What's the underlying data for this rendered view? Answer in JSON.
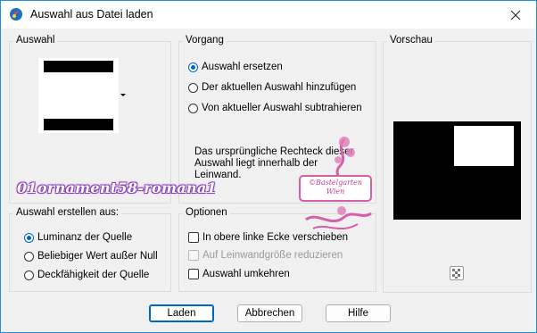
{
  "window": {
    "title": "Auswahl aus Datei laden"
  },
  "selection_panel": {
    "legend": "Auswahl"
  },
  "operation_panel": {
    "legend": "Vorgang",
    "options": [
      {
        "label": "Auswahl ersetzen",
        "selected": true
      },
      {
        "label": "Der aktuellen Auswahl hinzufügen",
        "selected": false
      },
      {
        "label": "Von aktueller Auswahl subtrahieren",
        "selected": false
      }
    ],
    "description": "Das ursprüngliche Rechteck dieser Auswahl liegt innerhalb der Leinwand."
  },
  "preview_panel": {
    "legend": "Vorschau"
  },
  "create_from_panel": {
    "legend": "Auswahl erstellen aus:",
    "options": [
      {
        "label": "Luminanz der Quelle",
        "selected": true
      },
      {
        "label": "Beliebiger Wert außer Null",
        "selected": false
      },
      {
        "label": "Deckfähigkeit der Quelle",
        "selected": false
      }
    ]
  },
  "options_panel": {
    "legend": "Optionen",
    "checks": [
      {
        "label": "In obere linke Ecke verschieben",
        "checked": false,
        "disabled": false
      },
      {
        "label": "Auf Leinwandgröße reduzieren",
        "checked": false,
        "disabled": true
      },
      {
        "label": "Auswahl umkehren",
        "checked": false,
        "disabled": false
      }
    ]
  },
  "buttons": {
    "load": "Laden",
    "cancel": "Abbrechen",
    "help": "Hilfe"
  },
  "watermark": {
    "text": "01ornament58-romana1",
    "stamp_lines": [
      "©Bastelgarten",
      "Wien"
    ]
  },
  "colors": {
    "accent": "#0067c0",
    "border": "#1e90e0",
    "background": "#f0f0f0"
  }
}
